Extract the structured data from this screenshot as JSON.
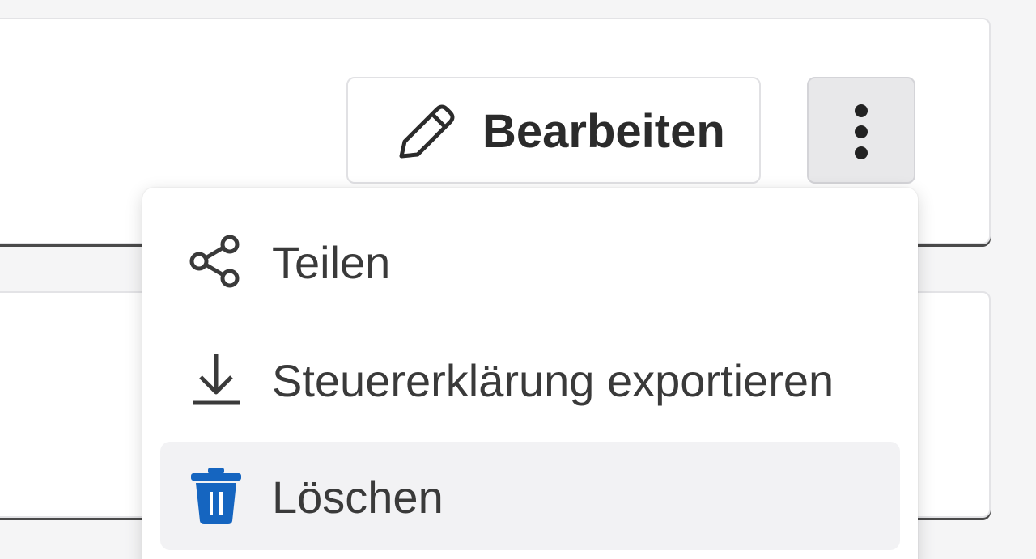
{
  "toolbar": {
    "edit_label": "Bearbeiten",
    "edit_icon": "pencil-icon",
    "more_icon": "more-vertical-icon"
  },
  "menu": {
    "items": [
      {
        "label": "Teilen",
        "icon": "share-icon"
      },
      {
        "label": "Steuererklärung exportieren",
        "icon": "download-icon"
      },
      {
        "label": "Löschen",
        "icon": "trash-icon",
        "icon_color": "#1565c0"
      }
    ]
  },
  "colors": {
    "accent": "#1565c0",
    "text": "#2b2b2b",
    "menu_text": "#3a3a3a",
    "hover_bg": "#f2f2f4"
  }
}
